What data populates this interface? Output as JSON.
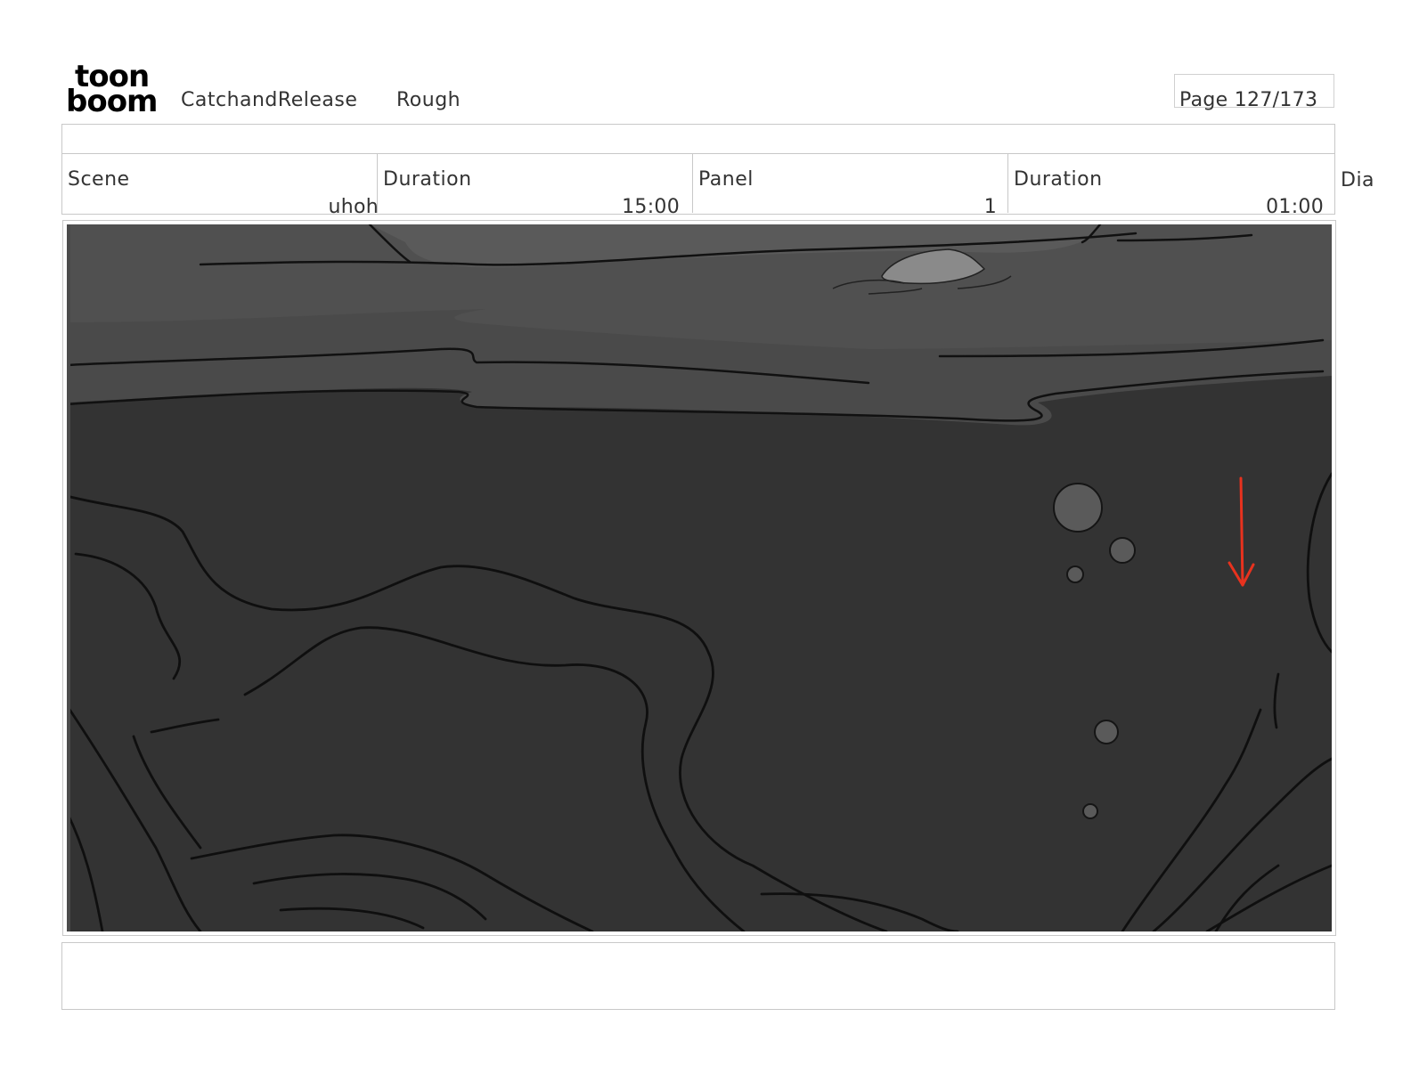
{
  "header": {
    "logo_line1": "toon",
    "logo_line2": "boom",
    "project_title": "CatchandRelease",
    "stage": "Rough",
    "page_label": "Page 127/173"
  },
  "info": {
    "scene_label": "Scene",
    "scene_value": "uhoh",
    "scene_duration_label": "Duration",
    "scene_duration_value": "15:00",
    "panel_label": "Panel",
    "panel_value": "1",
    "panel_duration_label": "Duration",
    "panel_duration_value": "01:00",
    "dialog_label": "Dia"
  },
  "colors": {
    "water_dark": "#333333",
    "water_light": "#4a4a4a",
    "arrow_red": "#e8321e"
  }
}
